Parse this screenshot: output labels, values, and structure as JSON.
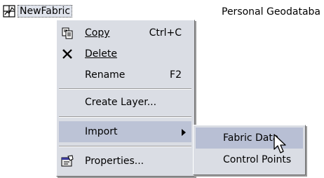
{
  "tree": {
    "label": "NewFabric",
    "icon": "fabric-icon"
  },
  "column": {
    "type": "Personal Geodataba"
  },
  "context_menu": {
    "items": [
      {
        "label": "Copy",
        "accel": "Ctrl+C",
        "icon": "copy-icon"
      },
      {
        "label": "Delete",
        "icon": "delete-x-icon"
      },
      {
        "label": "Rename",
        "accel": "F2"
      },
      {
        "label": "Create Layer..."
      },
      {
        "label": "Import",
        "submenu": true,
        "highlighted": true
      },
      {
        "label": "Properties...",
        "icon": "properties-icon"
      }
    ]
  },
  "submenu": {
    "items": [
      {
        "label": "Fabric Data",
        "highlighted": true
      },
      {
        "label": "Control Points"
      }
    ]
  },
  "colors": {
    "menu_bg": "#dadde4",
    "highlight": "#bcc3d6"
  }
}
